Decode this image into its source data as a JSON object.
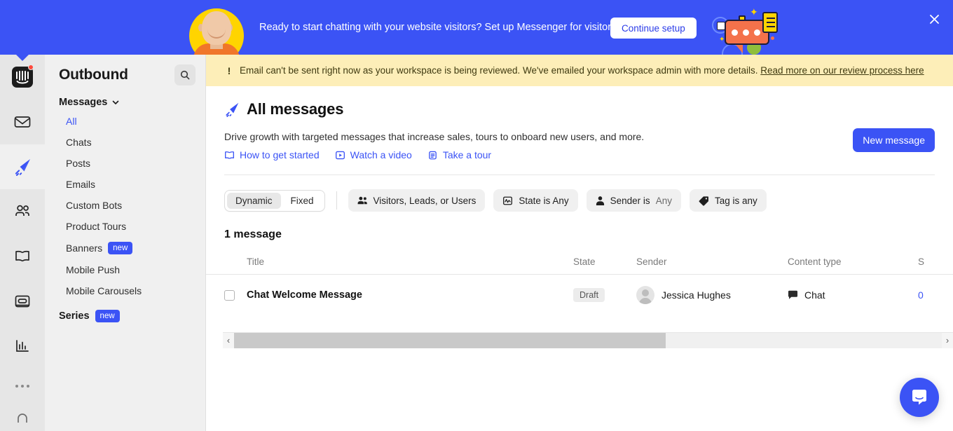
{
  "promo": {
    "message": "Ready to start chatting with your website visitors? Set up Messenger for visitors",
    "cta_label": "Continue setup",
    "close_icon": "close-icon",
    "bg_color": "#3b53f5"
  },
  "warning": {
    "icon": "!",
    "text": "Email can't be sent right now as your workspace is being reviewed. We've emailed your workspace admin with more details.",
    "link_text": "Read more on our review process here",
    "bg_color": "#fdeeb8"
  },
  "rail": {
    "items": [
      {
        "name": "intercom-logo",
        "label": "Intercom",
        "has_dot": true,
        "active": false
      },
      {
        "name": "inbox",
        "label": "Inbox",
        "has_dot": false,
        "active": false
      },
      {
        "name": "outbound",
        "label": "Outbound",
        "has_dot": false,
        "active": true
      },
      {
        "name": "contacts",
        "label": "Contacts",
        "has_dot": false,
        "active": false
      },
      {
        "name": "articles",
        "label": "Articles",
        "has_dot": false,
        "active": false
      },
      {
        "name": "messenger",
        "label": "Messenger",
        "has_dot": false,
        "active": false
      },
      {
        "name": "reports",
        "label": "Reports",
        "has_dot": false,
        "active": false
      }
    ],
    "more_label": "More",
    "bell_label": "Notifications"
  },
  "sidebar": {
    "title": "Outbound",
    "search_icon": "search-icon",
    "group_label": "Messages",
    "items": [
      {
        "label": "All",
        "active": true,
        "badge": ""
      },
      {
        "label": "Chats",
        "active": false,
        "badge": ""
      },
      {
        "label": "Posts",
        "active": false,
        "badge": ""
      },
      {
        "label": "Emails",
        "active": false,
        "badge": ""
      },
      {
        "label": "Custom Bots",
        "active": false,
        "badge": ""
      },
      {
        "label": "Product Tours",
        "active": false,
        "badge": ""
      },
      {
        "label": "Banners",
        "active": false,
        "badge": "new"
      },
      {
        "label": "Mobile Push",
        "active": false,
        "badge": ""
      },
      {
        "label": "Mobile Carousels",
        "active": false,
        "badge": ""
      }
    ],
    "series_label": "Series",
    "series_badge": "new"
  },
  "page": {
    "title": "All messages",
    "title_icon": "paper-plane-icon",
    "subtitle": "Drive growth with targeted messages that increase sales, tours to onboard new users, and more.",
    "new_message_label": "New message",
    "quicklinks": [
      {
        "label": "How to get started",
        "icon": "book-icon"
      },
      {
        "label": "Watch a video",
        "icon": "play-icon"
      },
      {
        "label": "Take a tour",
        "icon": "clipboard-icon"
      }
    ]
  },
  "filters": {
    "segmented": {
      "options": [
        "Dynamic",
        "Fixed"
      ],
      "selected": "Dynamic"
    },
    "pills": [
      {
        "icon": "people-icon",
        "label": "Visitors, Leads, or Users",
        "value": ""
      },
      {
        "icon": "pulse-icon",
        "label": "State is Any",
        "value": ""
      },
      {
        "icon": "person-icon",
        "label": "Sender is",
        "value": "Any"
      },
      {
        "icon": "tag-icon",
        "label": "Tag is any",
        "value": ""
      }
    ]
  },
  "table": {
    "count_label": "1 message",
    "columns": [
      "",
      "Title",
      "State",
      "Sender",
      "Content type",
      "S"
    ],
    "rows": [
      {
        "checked": false,
        "title": "Chat Welcome Message",
        "state": "Draft",
        "sender": "Jessica Hughes",
        "content_type": "Chat",
        "content_type_icon": "chat-icon",
        "s_value": "0"
      }
    ],
    "scrollbar": {
      "left_arrow": "‹",
      "right_arrow": "›"
    }
  },
  "launcher": {
    "icon": "intercom-messenger-icon",
    "color": "#3b53f5"
  }
}
